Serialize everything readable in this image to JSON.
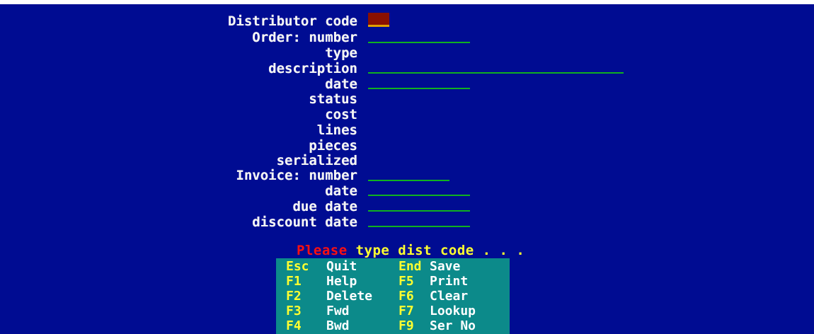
{
  "form": {
    "fields": [
      {
        "label": "Distributor code"
      },
      {
        "label": "Order: number"
      },
      {
        "label": "type"
      },
      {
        "label": "description"
      },
      {
        "label": "date"
      },
      {
        "label": "status"
      },
      {
        "label": "cost"
      },
      {
        "label": "lines"
      },
      {
        "label": "pieces"
      },
      {
        "label": "serialized"
      },
      {
        "label": "Invoice: number"
      },
      {
        "label": "date"
      },
      {
        "label": "due date"
      },
      {
        "label": "discount date"
      }
    ]
  },
  "prompt": {
    "word1": "Please",
    "rest": " type dist code . . ."
  },
  "keys": [
    {
      "key": "Esc",
      "action": "Quit",
      "key2": "End",
      "action2": "Save"
    },
    {
      "key": "F1",
      "action": "Help",
      "key2": "F5",
      "action2": "Print"
    },
    {
      "key": "F2",
      "action": "Delete",
      "key2": "F6",
      "action2": "Clear"
    },
    {
      "key": "F3",
      "action": "Fwd",
      "key2": "F7",
      "action2": "Lookup"
    },
    {
      "key": "F4",
      "action": "Bwd",
      "key2": "F9",
      "action2": "Ser No"
    }
  ],
  "colors": {
    "background": "#000c92",
    "field_line": "#10b020",
    "panel": "#0c8a8a",
    "key_text": "#ffff30",
    "prompt_red": "#ff1010",
    "cursor": "#8a1000"
  }
}
